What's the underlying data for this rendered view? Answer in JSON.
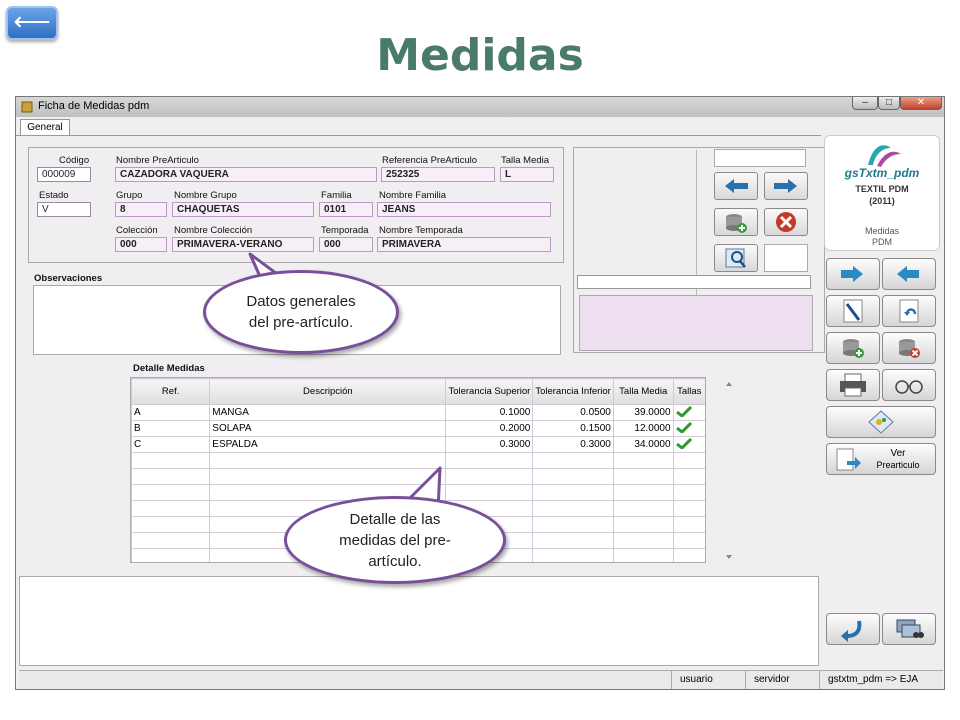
{
  "slide": {
    "back_arrow": "⟵",
    "title": "Medidas"
  },
  "window": {
    "title": "Ficha de Medidas pdm",
    "controls": {
      "minimize": "–",
      "maximize": "□",
      "close": "✕"
    },
    "tab": "General"
  },
  "general": {
    "codigo": {
      "label": "Código",
      "value": "000009"
    },
    "nombre_prearticulo": {
      "label": "Nombre PreArticulo",
      "value": "CAZADORA VAQUERA"
    },
    "referencia": {
      "label": "Referencia PreArticulo",
      "value": "252325"
    },
    "talla_media": {
      "label": "Talla Media",
      "value": "L"
    },
    "estado": {
      "label": "Estado",
      "value": "V"
    },
    "grupo": {
      "label": "Grupo",
      "value": "8"
    },
    "nombre_grupo": {
      "label": "Nombre Grupo",
      "value": "CHAQUETAS"
    },
    "familia": {
      "label": "Familia",
      "value": "0101"
    },
    "nombre_familia": {
      "label": "Nombre Familia",
      "value": "JEANS"
    },
    "coleccion": {
      "label": "Colección",
      "value": "000"
    },
    "nombre_coleccion": {
      "label": "Nombre Colección",
      "value": "PRIMAVERA-VERANO"
    },
    "temporada": {
      "label": "Temporada",
      "value": "000"
    },
    "nombre_temporada": {
      "label": "Nombre Temporada",
      "value": "PRIMAVERA"
    }
  },
  "observaciones": {
    "label": "Observaciones",
    "value": ""
  },
  "detalle": {
    "label": "Detalle Medidas",
    "columns": [
      "Ref.",
      "Descripción",
      "Tolerancia Superior",
      "Tolerancia Inferior",
      "Talla Media",
      "Tallas"
    ],
    "rows": [
      {
        "ref": "A",
        "desc": "MANGA",
        "sup": "0.1000",
        "inf": "0.0500",
        "media": "39.0000"
      },
      {
        "ref": "B",
        "desc": "SOLAPA",
        "sup": "0.2000",
        "inf": "0.1500",
        "media": "12.0000"
      },
      {
        "ref": "C",
        "desc": "ESPALDA",
        "sup": "0.3000",
        "inf": "0.3000",
        "media": "34.0000"
      }
    ]
  },
  "logo": {
    "brand": "gsTxtm_pdm",
    "line1": "TEXTIL PDM",
    "line2": "(2011)",
    "module1": "Medidas",
    "module2": "PDM"
  },
  "side_buttons": {
    "ver_line1": "Ver",
    "ver_line2": "Prearticulo"
  },
  "callouts": {
    "datos": "Datos generales del pre-artículo.",
    "detalle": "Detalle de las medidas del pre-artículo."
  },
  "status": {
    "usuario": "usuario",
    "servidor": "servidor",
    "conexion": "gstxtm_pdm => EJA"
  },
  "colors": {
    "accent_purple": "#7a4f9a",
    "title_green": "#4a7a6c",
    "field_bg": "#f8eef8"
  }
}
